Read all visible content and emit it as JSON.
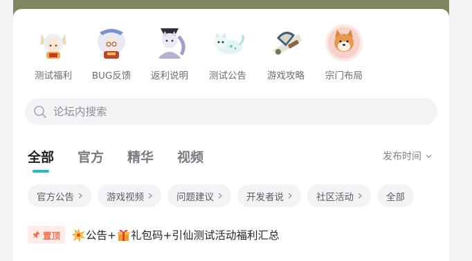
{
  "entries": [
    {
      "label": "测试福利",
      "icon": "fox-girl-icon"
    },
    {
      "label": "BUG反馈",
      "icon": "white-hair-girl-icon"
    },
    {
      "label": "返利说明",
      "icon": "cat-swordsman-icon"
    },
    {
      "label": "测试公告",
      "icon": "white-cat-icon"
    },
    {
      "label": "游戏攻略",
      "icon": "fan-scroll-icon"
    },
    {
      "label": "宗门布局",
      "icon": "shiba-dog-icon"
    }
  ],
  "search": {
    "placeholder": "论坛内搜索"
  },
  "tabs": [
    {
      "label": "全部",
      "active": true
    },
    {
      "label": "官方",
      "active": false
    },
    {
      "label": "精华",
      "active": false
    },
    {
      "label": "视频",
      "active": false
    }
  ],
  "sort": {
    "label": "发布时间"
  },
  "chips": [
    {
      "label": "官方公告",
      "arrow": true
    },
    {
      "label": "游戏视频",
      "arrow": true
    },
    {
      "label": "问题建议",
      "arrow": true
    },
    {
      "label": "开发者说",
      "arrow": true
    },
    {
      "label": "社区活动",
      "arrow": true
    },
    {
      "label": "全部",
      "arrow": false
    }
  ],
  "pinned_post": {
    "badge": "置顶",
    "title_part1": "公告+",
    "title_part2": "礼包码+引仙测试活动福利汇总"
  },
  "colors": {
    "accent": "#2bb8c5",
    "pin_text": "#f0704f",
    "pin_bg": "#fdece7",
    "banner": "#7f8461"
  }
}
